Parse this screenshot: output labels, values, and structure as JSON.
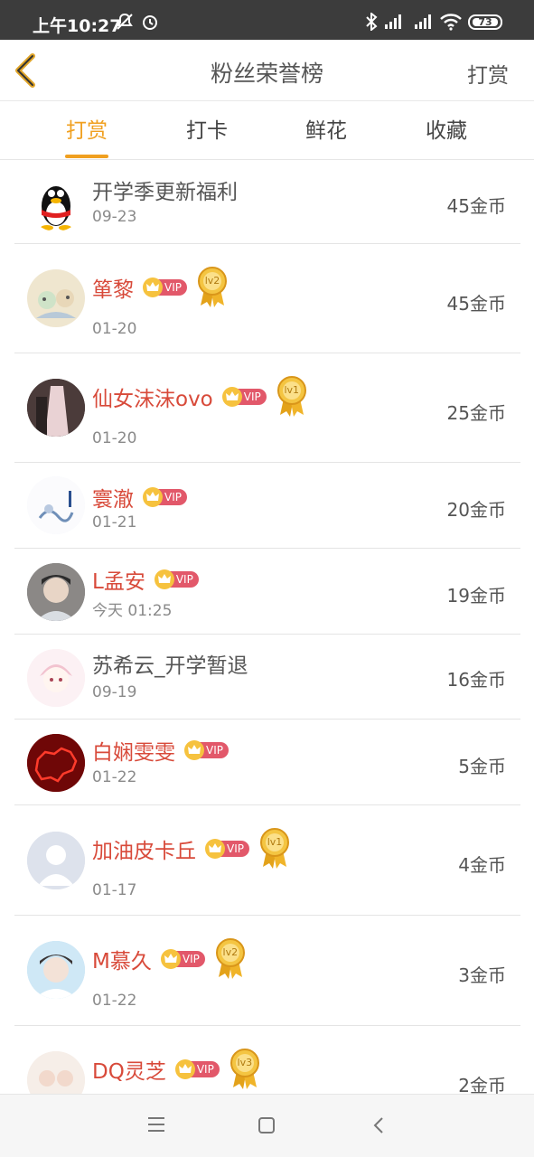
{
  "status_bar": {
    "time": "上午10:27",
    "battery": "73"
  },
  "navbar": {
    "title": "粉丝荣誉榜",
    "right_action": "打赏"
  },
  "tabs": [
    {
      "label": "打赏",
      "active": true
    },
    {
      "label": "打卡",
      "active": false
    },
    {
      "label": "鲜花",
      "active": false
    },
    {
      "label": "收藏",
      "active": false
    }
  ],
  "list": [
    {
      "name": "开学季更新福利",
      "date": "09-23",
      "amount": "45金币",
      "vip": false,
      "medal": ""
    },
    {
      "name": "箪黎",
      "date": "01-20",
      "amount": "45金币",
      "vip": true,
      "medal": "lv2"
    },
    {
      "name": "仙女沫沫ovo",
      "date": "01-20",
      "amount": "25金币",
      "vip": true,
      "medal": "lv1"
    },
    {
      "name": "寰澈",
      "date": "01-21",
      "amount": "20金币",
      "vip": true,
      "medal": ""
    },
    {
      "name": "L孟安",
      "date": "今天 01:25",
      "amount": "19金币",
      "vip": true,
      "medal": ""
    },
    {
      "name": "苏希云_开学暂退",
      "date": "09-19",
      "amount": "16金币",
      "vip": false,
      "medal": ""
    },
    {
      "name": "白娴雯雯",
      "date": "01-22",
      "amount": "5金币",
      "vip": true,
      "medal": ""
    },
    {
      "name": "加油皮卡丘",
      "date": "01-17",
      "amount": "4金币",
      "vip": true,
      "medal": "lv1"
    },
    {
      "name": "M慕久",
      "date": "01-22",
      "amount": "3金币",
      "vip": true,
      "medal": "lv2"
    },
    {
      "name": "DQ灵芝",
      "date": "",
      "amount": "2金币",
      "vip": true,
      "medal": "lv3"
    }
  ],
  "vip_label": "VIP",
  "colors": {
    "accent": "#f0a020",
    "vip_name": "#d84a3a",
    "vip_tag": "#e2586a"
  }
}
